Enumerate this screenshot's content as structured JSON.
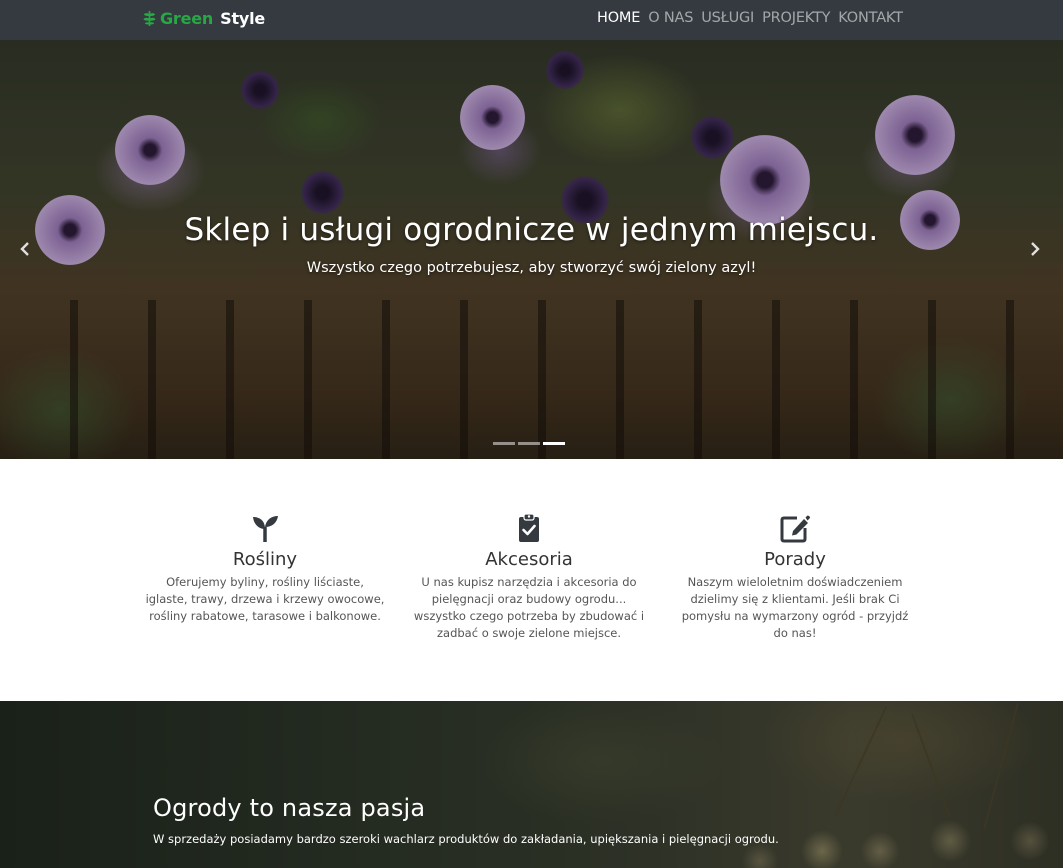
{
  "navbar": {
    "brand_part1": "Green",
    "brand_part2": "Style",
    "links": [
      "HOME",
      "O NAS",
      "USŁUGI",
      "PROJEKTY",
      "KONTAKT"
    ],
    "active_index": 0
  },
  "hero": {
    "title": "Sklep i usługi ogrodnicze w jednym miejscu.",
    "subtitle": "Wszystko czego potrzebujesz, aby stworzyć swój zielony azyl!",
    "slide_count": 3,
    "active_slide": 3
  },
  "features": [
    {
      "icon": "seedling-icon",
      "title": "Rośliny",
      "text": "Oferujemy byliny, rośliny liściaste, iglaste, trawy, drzewa i krzewy owocowe, rośliny rabatowe, tarasowe i balkonowe."
    },
    {
      "icon": "clipboard-check-icon",
      "title": "Akcesoria",
      "text": "U nas kupisz narzędzia i akcesoria do pielęgnacji oraz budowy ogrodu... wszystko czego potrzeba by zbudować i zadbać o swoje zielone miejsce."
    },
    {
      "icon": "edit-icon",
      "title": "Porady",
      "text": "Naszym wieloletnim doświadczeniem dzielimy się z klientami. Jeśli brak Ci pomysłu na wymarzony ogród - przyjdź do nas!"
    }
  ],
  "passion": {
    "title": "Ogrody to nasza pasja",
    "text": "W sprzedaży posiadamy bardzo szeroki wachlarz produktów do zakładania, upiększania i pielęgnacji ogrodu."
  },
  "colors": {
    "navbar_bg": "#343a40",
    "brand_green": "#28a745",
    "text_dark": "#333333"
  }
}
